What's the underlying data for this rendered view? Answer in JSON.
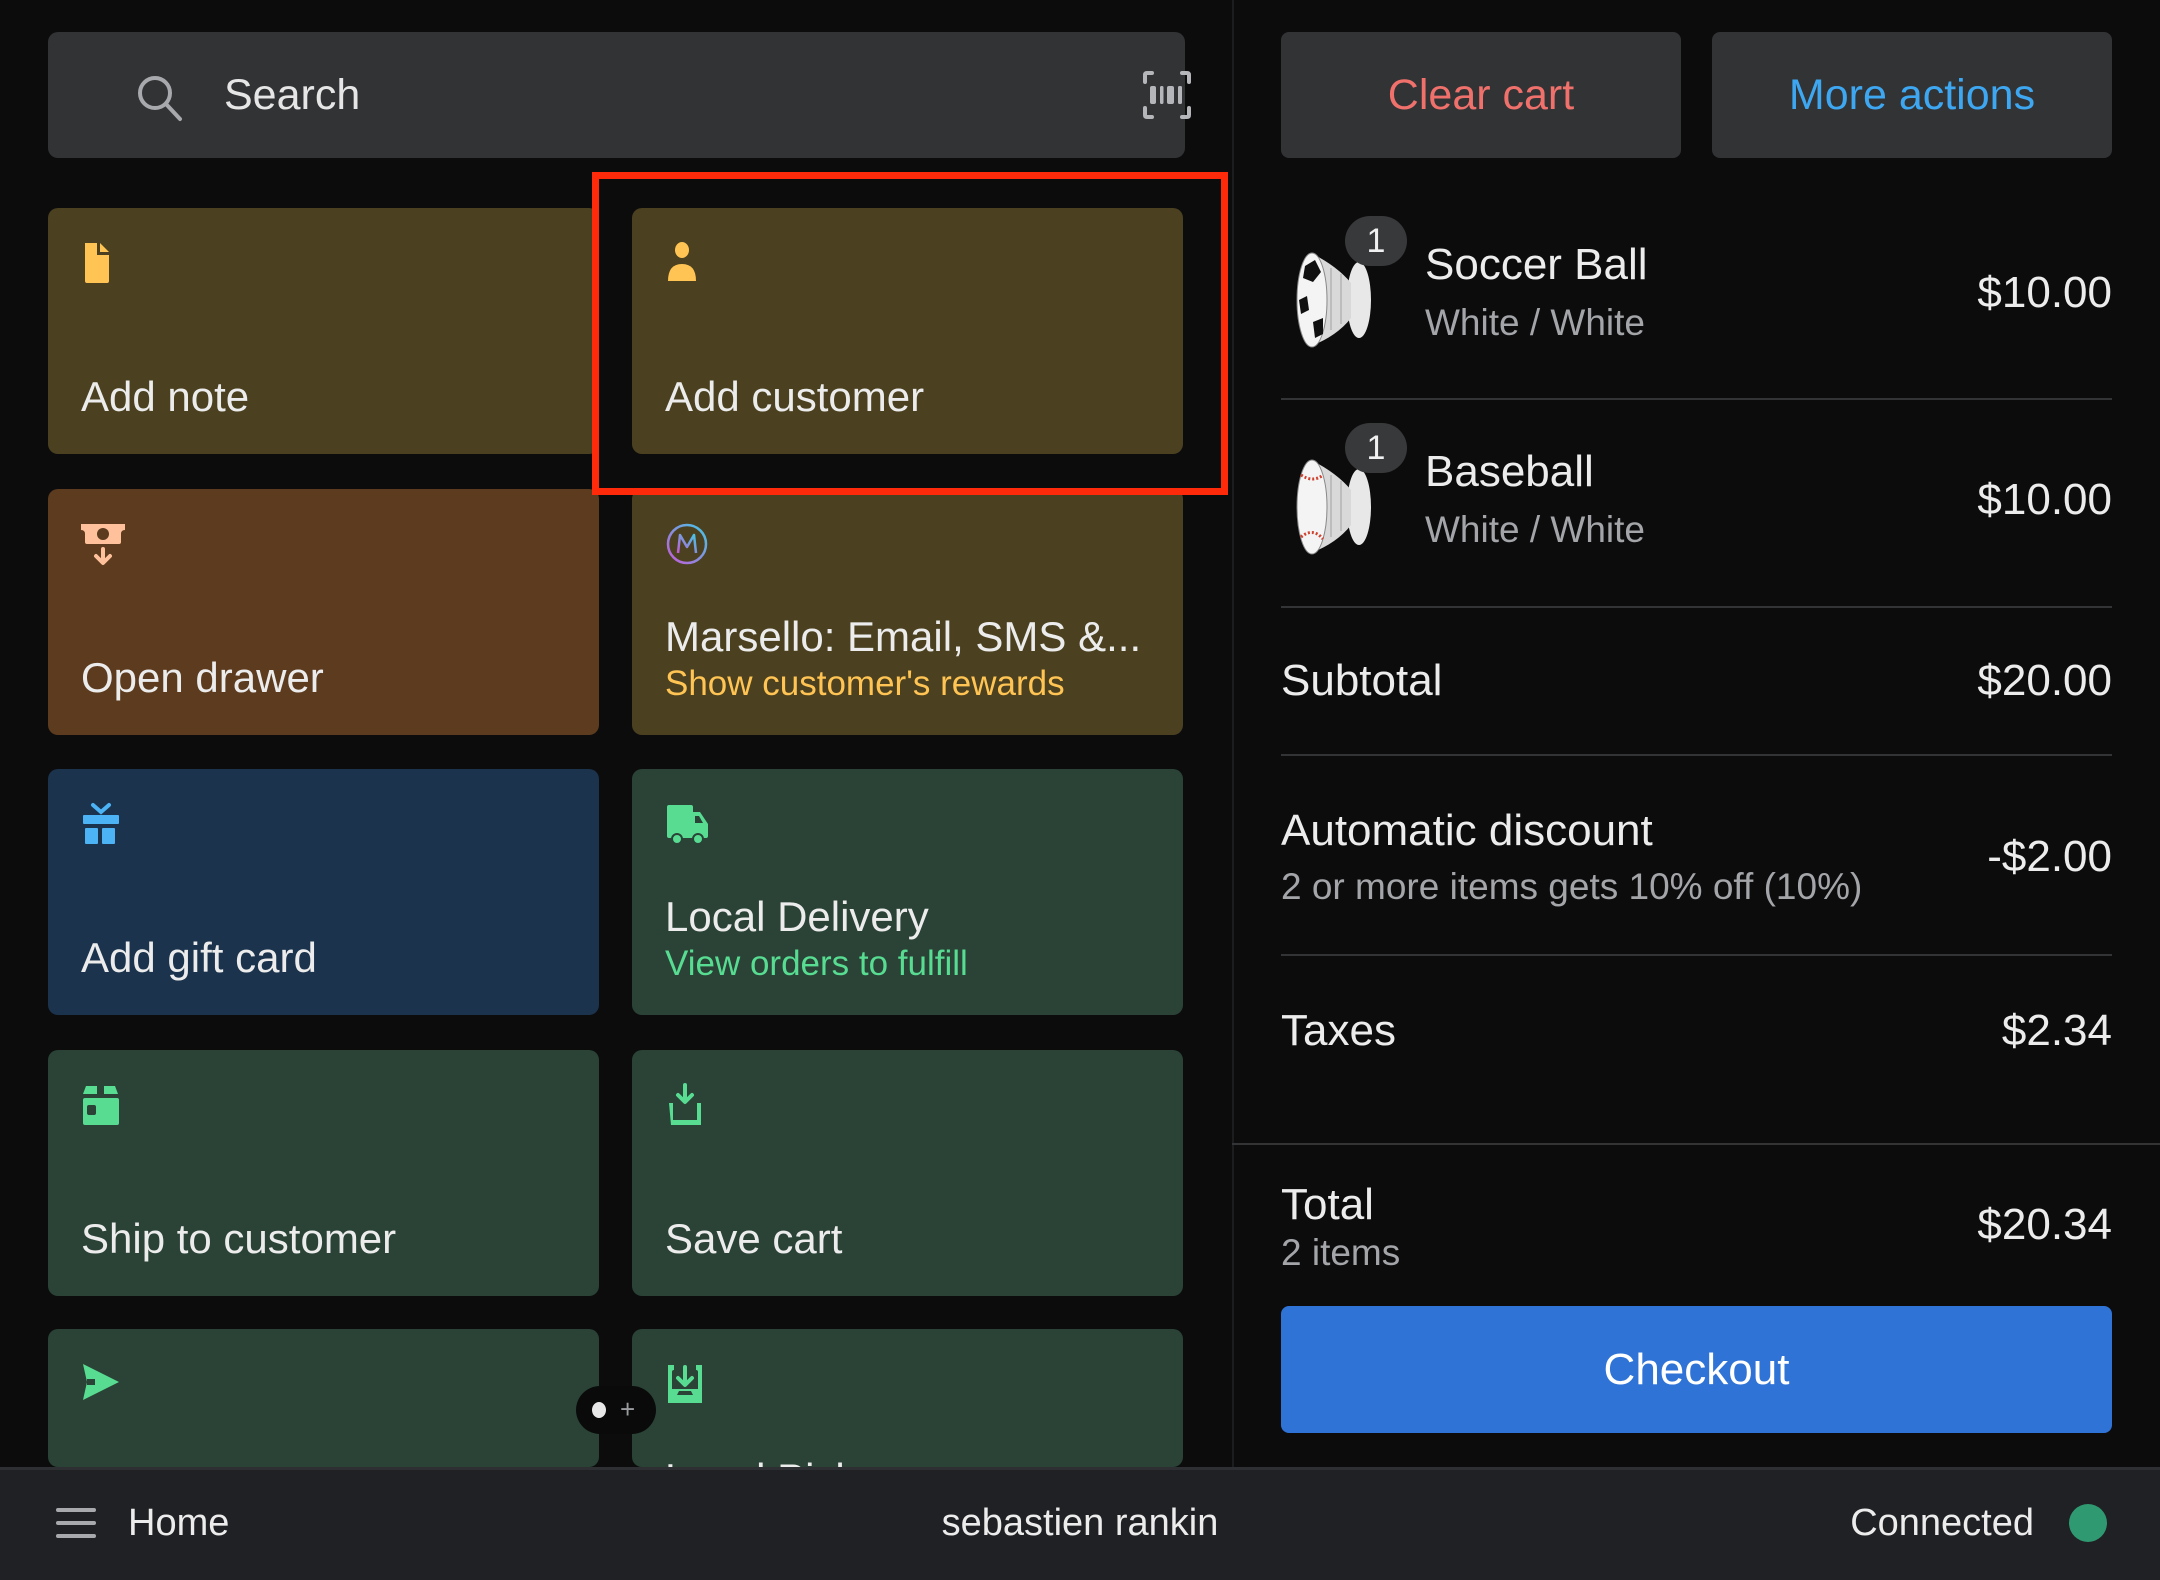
{
  "search": {
    "placeholder": "Search",
    "search_icon": "search-icon",
    "scan_icon": "barcode-scan-icon"
  },
  "tiles": [
    {
      "label": "Add note",
      "subtitle": null,
      "icon": "note-icon",
      "icon_color": "#ffc453",
      "bg": "#4b4120"
    },
    {
      "label": "Add customer",
      "subtitle": null,
      "icon": "person-icon",
      "icon_color": "#ffc453",
      "bg": "#4b4120",
      "highlighted": true
    },
    {
      "label": "Open drawer",
      "subtitle": null,
      "icon": "cash-drawer-icon",
      "icon_color": "#ffc19b",
      "bg": "#5c3b1f"
    },
    {
      "label": "Marsello: Email, SMS &...",
      "subtitle": "Show customer's rewards",
      "subtitle_color": "#ffc453",
      "icon": "marsello-logo-icon",
      "bg": "#4b4120"
    },
    {
      "label": "Add gift card",
      "subtitle": null,
      "icon": "gift-icon",
      "icon_color": "#4cb3f5",
      "bg": "#1b334d"
    },
    {
      "label": "Local Delivery",
      "subtitle": "View orders to fulfill",
      "subtitle_color": "#57dc92",
      "icon": "truck-icon",
      "icon_color": "#57dc92",
      "bg": "#2a4336"
    },
    {
      "label": "Ship to customer",
      "subtitle": null,
      "icon": "package-icon",
      "icon_color": "#57dc92",
      "bg": "#2a4336"
    },
    {
      "label": "Save cart",
      "subtitle": null,
      "icon": "save-download-icon",
      "icon_color": "#57dc92",
      "bg": "#2a4336"
    },
    {
      "label": "",
      "subtitle": null,
      "icon": "send-arrow-icon",
      "icon_color": "#57dc92",
      "bg": "#2a4336"
    },
    {
      "label": "Local Pickup",
      "subtitle": null,
      "icon": "pickup-inbox-icon",
      "icon_color": "#57dc92",
      "bg": "#2a4336"
    }
  ],
  "cart": {
    "clear_label": "Clear cart",
    "more_label": "More actions",
    "items": [
      {
        "name": "Soccer Ball",
        "variant": "White / White",
        "qty": "1",
        "price": "$10.00",
        "thumb": "soccer-ball-product-image"
      },
      {
        "name": "Baseball",
        "variant": "White / White",
        "qty": "1",
        "price": "$10.00",
        "thumb": "baseball-product-image"
      }
    ],
    "subtotal": {
      "label": "Subtotal",
      "value": "$20.00"
    },
    "discount": {
      "label": "Automatic discount",
      "description": "2 or more items gets 10% off (10%)",
      "value": "-$2.00"
    },
    "taxes": {
      "label": "Taxes",
      "value": "$2.34"
    },
    "total": {
      "label": "Total",
      "items_count": "2 items",
      "value": "$20.34"
    },
    "checkout_label": "Checkout"
  },
  "bottombar": {
    "menu_icon": "hamburger-menu-icon",
    "home_label": "Home",
    "user_name": "sebastien rankin",
    "status_label": "Connected",
    "status_color": "#2f9a72"
  },
  "colors": {
    "accent_blue": "#2f73d6",
    "danger": "#f0716b",
    "link": "#3ea7f2",
    "highlight_box": "#ff2a0a"
  }
}
